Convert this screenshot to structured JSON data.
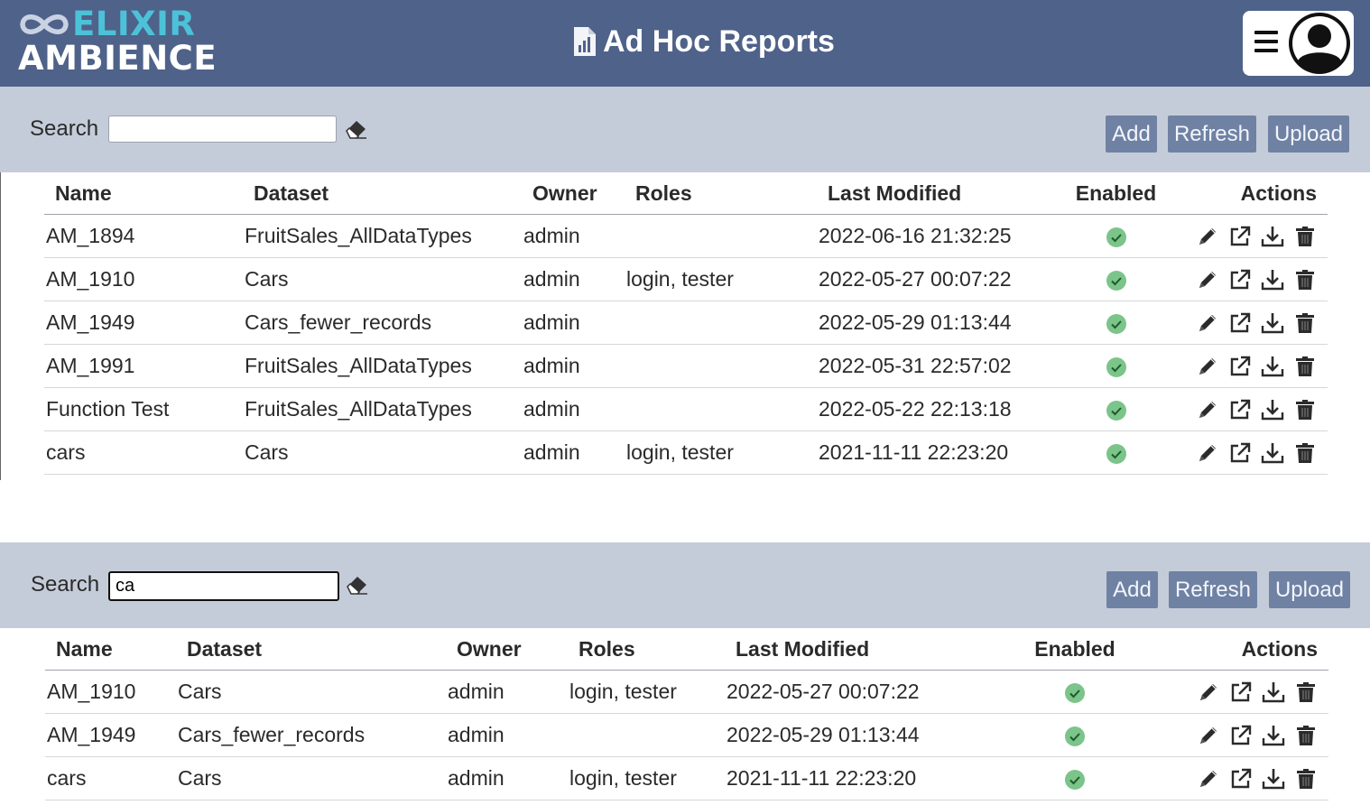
{
  "header": {
    "logo_top": "ELIXIR",
    "logo_bottom": "AMBIENCE",
    "title": "Ad Hoc Reports"
  },
  "colors": {
    "header_bg": "#4f6289",
    "toolbar_bg": "#c5ccd9",
    "button_bg": "#6f82a4",
    "enabled_green": "#7bc48a",
    "logo_accent": "#4cc2d8"
  },
  "icons": {
    "title": "report-chart-icon",
    "menu": "hamburger-menu-icon",
    "user": "user-avatar-icon",
    "clear": "eraser-icon",
    "enabled": "check-circle-icon",
    "edit": "pencil-icon",
    "open": "external-link-icon",
    "download": "download-icon",
    "delete": "trash-icon"
  },
  "toolbar": {
    "search_label": "Search",
    "add_label": "Add",
    "refresh_label": "Refresh",
    "upload_label": "Upload"
  },
  "columns": {
    "name": "Name",
    "dataset": "Dataset",
    "owner": "Owner",
    "roles": "Roles",
    "modified": "Last Modified",
    "enabled": "Enabled",
    "actions": "Actions"
  },
  "panel1": {
    "search_value": "",
    "rows": [
      {
        "name": "AM_1894",
        "dataset": "FruitSales_AllDataTypes",
        "owner": "admin",
        "roles": "",
        "modified": "2022-06-16 21:32:25",
        "enabled": true
      },
      {
        "name": "AM_1910",
        "dataset": "Cars",
        "owner": "admin",
        "roles": "login, tester",
        "modified": "2022-05-27 00:07:22",
        "enabled": true
      },
      {
        "name": "AM_1949",
        "dataset": "Cars_fewer_records",
        "owner": "admin",
        "roles": "",
        "modified": "2022-05-29 01:13:44",
        "enabled": true
      },
      {
        "name": "AM_1991",
        "dataset": "FruitSales_AllDataTypes",
        "owner": "admin",
        "roles": "",
        "modified": "2022-05-31 22:57:02",
        "enabled": true
      },
      {
        "name": "Function Test",
        "dataset": "FruitSales_AllDataTypes",
        "owner": "admin",
        "roles": "",
        "modified": "2022-05-22 22:13:18",
        "enabled": true
      },
      {
        "name": "cars",
        "dataset": "Cars",
        "owner": "admin",
        "roles": "login, tester",
        "modified": "2021-11-11 22:23:20",
        "enabled": true
      }
    ]
  },
  "panel2": {
    "search_value": "ca",
    "rows": [
      {
        "name": "AM_1910",
        "dataset": "Cars",
        "owner": "admin",
        "roles": "login, tester",
        "modified": "2022-05-27 00:07:22",
        "enabled": true
      },
      {
        "name": "AM_1949",
        "dataset": "Cars_fewer_records",
        "owner": "admin",
        "roles": "",
        "modified": "2022-05-29 01:13:44",
        "enabled": true
      },
      {
        "name": "cars",
        "dataset": "Cars",
        "owner": "admin",
        "roles": "login, tester",
        "modified": "2021-11-11 22:23:20",
        "enabled": true
      }
    ]
  }
}
